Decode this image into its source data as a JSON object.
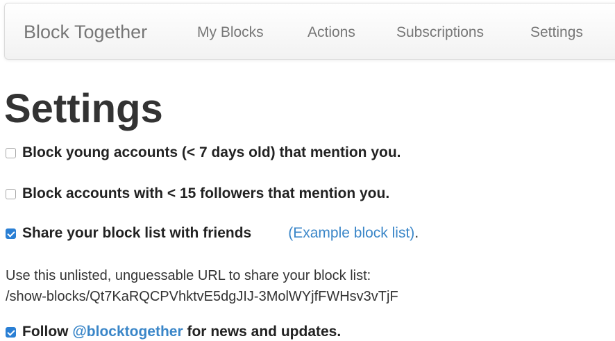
{
  "navbar": {
    "brand": "Block Together",
    "items": [
      {
        "label": "My Blocks"
      },
      {
        "label": "Actions"
      },
      {
        "label": "Subscriptions"
      },
      {
        "label": "Settings"
      }
    ]
  },
  "page": {
    "title": "Settings"
  },
  "settings": {
    "block_young": {
      "label": "Block young accounts (< 7 days old) that mention you.",
      "checked": false
    },
    "block_few_followers": {
      "label": "Block accounts with < 15 followers that mention you.",
      "checked": false
    },
    "share_list": {
      "label": "Share your block list with friends",
      "checked": true,
      "example_link": "(Example block list)",
      "trailing": "."
    },
    "share_url": {
      "description": "Use this unlisted, unguessable URL to share your block list:",
      "url": "/show-blocks/Qt7KaRQCPVhktvE5dgJIJ-3MolWYjfFWHsv3vTjF"
    },
    "follow": {
      "prefix": "Follow ",
      "handle": "@blocktogether",
      "suffix": " for news and updates.",
      "checked": true
    }
  },
  "colors": {
    "link": "#3a86c8",
    "checkbox_checked": "#2a7fd4",
    "nav_text": "#777777"
  }
}
